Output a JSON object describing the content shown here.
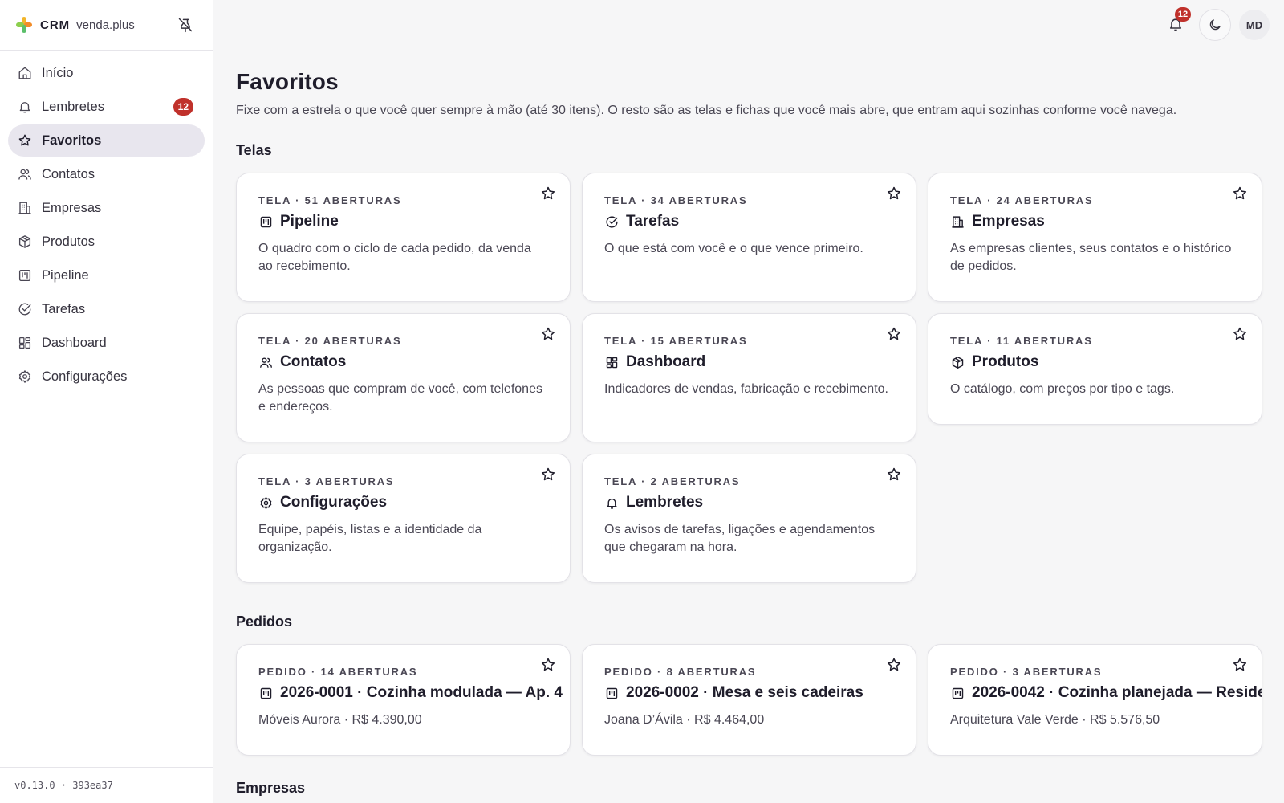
{
  "brand": {
    "crm": "CRM",
    "name": "venda.plus"
  },
  "sidebar": {
    "items": [
      {
        "label": "Início",
        "icon": "home-icon"
      },
      {
        "label": "Lembretes",
        "icon": "bell-icon",
        "badge": "12"
      },
      {
        "label": "Favoritos",
        "icon": "star-icon",
        "active": true
      },
      {
        "label": "Contatos",
        "icon": "users-icon"
      },
      {
        "label": "Empresas",
        "icon": "building-icon"
      },
      {
        "label": "Produtos",
        "icon": "package-icon"
      },
      {
        "label": "Pipeline",
        "icon": "kanban-icon"
      },
      {
        "label": "Tarefas",
        "icon": "check-circle-icon"
      },
      {
        "label": "Dashboard",
        "icon": "dashboard-icon"
      },
      {
        "label": "Configurações",
        "icon": "gear-icon"
      }
    ],
    "version": "v0.13.0 · 393ea37"
  },
  "topbar": {
    "notifications": "12",
    "avatar": "MD"
  },
  "page": {
    "title": "Favoritos",
    "description": "Fixe com a estrela o que você quer sempre à mão (até 30 itens). O resto são as telas e fichas que você mais abre, que entram aqui sozinhas conforme você navega."
  },
  "sections": {
    "telas": {
      "title": "Telas",
      "cards": [
        {
          "meta": "TELA · 51 ABERTURAS",
          "title": "Pipeline",
          "icon": "kanban-icon",
          "desc": "O quadro com o ciclo de cada pedido, da venda ao recebimento."
        },
        {
          "meta": "TELA · 34 ABERTURAS",
          "title": "Tarefas",
          "icon": "check-circle-icon",
          "desc": "O que está com você e o que vence primeiro."
        },
        {
          "meta": "TELA · 24 ABERTURAS",
          "title": "Empresas",
          "icon": "building-icon",
          "desc": "As empresas clientes, seus contatos e o histórico de pedidos."
        },
        {
          "meta": "TELA · 20 ABERTURAS",
          "title": "Contatos",
          "icon": "users-icon",
          "desc": "As pessoas que compram de você, com telefones e endereços."
        },
        {
          "meta": "TELA · 15 ABERTURAS",
          "title": "Dashboard",
          "icon": "dashboard-icon",
          "desc": "Indicadores de vendas, fabricação e recebimento."
        },
        {
          "meta": "TELA · 11 ABERTURAS",
          "title": "Produtos",
          "icon": "package-icon",
          "desc": "O catálogo, com preços por tipo e tags."
        },
        {
          "meta": "TELA · 3 ABERTURAS",
          "title": "Configurações",
          "icon": "gear-icon",
          "desc": "Equipe, papéis, listas e a identidade da organização."
        },
        {
          "meta": "TELA · 2 ABERTURAS",
          "title": "Lembretes",
          "icon": "bell-icon",
          "desc": "Os avisos de tarefas, ligações e agendamentos que chegaram na hora."
        }
      ]
    },
    "pedidos": {
      "title": "Pedidos",
      "cards": [
        {
          "meta": "PEDIDO · 14 ABERTURAS",
          "title": "2026-0001 · Cozinha modulada — Ap. 4",
          "icon": "kanban-icon",
          "desc": "Móveis Aurora · R$ 4.390,00"
        },
        {
          "meta": "PEDIDO · 8 ABERTURAS",
          "title": "2026-0002 · Mesa e seis cadeiras",
          "icon": "kanban-icon",
          "desc": "Joana D’Ávila · R$ 4.464,00"
        },
        {
          "meta": "PEDIDO · 3 ABERTURAS",
          "title": "2026-0042 · Cozinha planejada — Reside",
          "icon": "kanban-icon",
          "desc": "Arquitetura Vale Verde · R$ 5.576,50"
        }
      ]
    },
    "empresas": {
      "title": "Empresas"
    }
  },
  "colors": {
    "accent_bg": "#e8e6ee",
    "badge": "#c0312b",
    "text": "#1f1d2b"
  }
}
